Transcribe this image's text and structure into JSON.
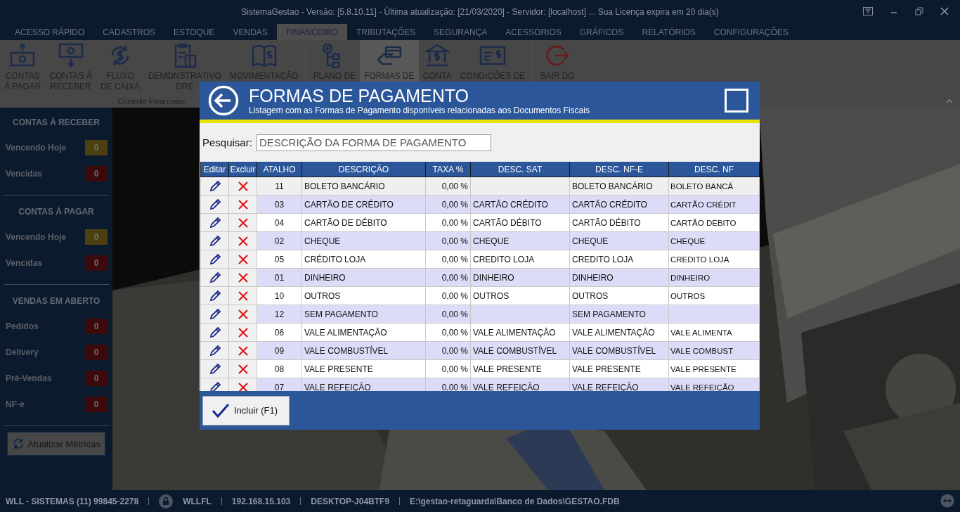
{
  "window": {
    "title": "SistemaGestao - Versão: [5.8.10.11] - Última atualização: [21/03/2020] - Servidor: [localhost] ... Sua Licença expira em 20 dia(s)"
  },
  "tabs": [
    {
      "label": "ACESSO RÁPIDO",
      "selected": false
    },
    {
      "label": "CADASTROS",
      "selected": false
    },
    {
      "label": "ESTOQUE",
      "selected": false
    },
    {
      "label": "VENDAS",
      "selected": false
    },
    {
      "label": "FINANCEIRO",
      "selected": true
    },
    {
      "label": "TRIBUTAÇÕES",
      "selected": false
    },
    {
      "label": "SEGURANÇA",
      "selected": false
    },
    {
      "label": "ACESSÓRIOS",
      "selected": false
    },
    {
      "label": "GRÁFICOS",
      "selected": false
    },
    {
      "label": "RELATÓRIOS",
      "selected": false
    },
    {
      "label": "CONFIGURAÇÕES",
      "selected": false
    }
  ],
  "ribbon": {
    "group_label": "Controle Financeiro",
    "items": [
      {
        "lines": [
          "CONTAS",
          "À PAGAR"
        ],
        "selected": false
      },
      {
        "lines": [
          "CONTAS À",
          "RECEBER"
        ],
        "selected": false
      },
      {
        "lines": [
          "FLUXO",
          "DE CAIXA"
        ],
        "selected": false
      },
      {
        "lines": [
          "DEMONSTRATIVO",
          "DRE"
        ],
        "selected": false
      },
      {
        "lines": [
          "MOVIMENTAÇÃO"
        ],
        "selected": false
      },
      {
        "lines": [
          "PLANO DE"
        ],
        "selected": false
      },
      {
        "lines": [
          "FORMAS DE"
        ],
        "selected": true
      },
      {
        "lines": [
          "CONTA"
        ],
        "selected": false
      },
      {
        "lines": [
          "CONDIÇÕES DE"
        ],
        "selected": false
      },
      {
        "lines": [
          "SAIR DO"
        ],
        "selected": false
      }
    ]
  },
  "sidebar": {
    "sections": [
      {
        "title": "CONTAS À RECEBER",
        "items": [
          {
            "label": "Vencendo Hoje",
            "count": "0",
            "color": "#4d3f0f"
          },
          {
            "label": "Vencidas",
            "count": "0",
            "color": "#3d0a0c"
          }
        ]
      },
      {
        "title": "CONTAS À PAGAR",
        "items": [
          {
            "label": "Vencendo Hoje",
            "count": "0",
            "color": "#4d3f0f"
          },
          {
            "label": "Vencidas",
            "count": "0",
            "color": "#3d0a0c"
          }
        ]
      },
      {
        "title": "VENDAS EM ABERTO",
        "items": [
          {
            "label": "Pedidos",
            "count": "0",
            "color": "#3d0a0c"
          },
          {
            "label": "Delivery",
            "count": "0",
            "color": "#3d0a0c"
          },
          {
            "label": "Pré-Vendas",
            "count": "0",
            "color": "#3d0a0c"
          },
          {
            "label": "NF-e",
            "count": "0",
            "color": "#3d0a0c"
          }
        ]
      }
    ],
    "refresh_button": "Atualizar Métricas"
  },
  "dialog": {
    "title": "FORMAS DE PAGAMENTO",
    "subtitle": "Listagem com as Formas de Pagamento disponíveis relacionadas aos Documentos Fiscais",
    "search": {
      "label": "Pesquisar:",
      "placeholder": "DESCRIÇÃO DA FORMA DE PAGAMENTO"
    },
    "table": {
      "columns": [
        "Editar",
        "Excluir",
        "ATALHO",
        "DESCRIÇÃO",
        "TAXA %",
        "DESC. SAT",
        "DESC. NF-E",
        "DESC. NF"
      ],
      "rows": [
        {
          "atalho": "11",
          "descricao": "BOLETO BANCÁRIO",
          "taxa": "0,00 %",
          "desc_sat": "",
          "desc_nfe": "BOLETO BANCÁRIO",
          "desc_nf": "BOLETO BANCÁ",
          "selected": true
        },
        {
          "atalho": "03",
          "descricao": "CARTÃO DE CRÉDITO",
          "taxa": "0,00 %",
          "desc_sat": "CARTÃO CRÉDITO",
          "desc_nfe": "CARTÃO CRÉDITO",
          "desc_nf": "CARTÃO CRÉDIT",
          "selected": false
        },
        {
          "atalho": "04",
          "descricao": "CARTÃO DE DÉBITO",
          "taxa": "0,00 %",
          "desc_sat": "CARTÃO DÉBITO",
          "desc_nfe": "CARTÃO DÉBITO",
          "desc_nf": "CARTÃO DÉBITO",
          "selected": false
        },
        {
          "atalho": "02",
          "descricao": "CHEQUE",
          "taxa": "0,00 %",
          "desc_sat": "CHEQUE",
          "desc_nfe": "CHEQUE",
          "desc_nf": "CHEQUE",
          "selected": false
        },
        {
          "atalho": "05",
          "descricao": "CRÉDITO LOJA",
          "taxa": "0,00 %",
          "desc_sat": "CREDITO LOJA",
          "desc_nfe": "CREDITO LOJA",
          "desc_nf": "CREDITO LOJA",
          "selected": false
        },
        {
          "atalho": "01",
          "descricao": "DINHEIRO",
          "taxa": "0,00 %",
          "desc_sat": "DINHEIRO",
          "desc_nfe": "DINHEIRO",
          "desc_nf": "DINHEIRO",
          "selected": false
        },
        {
          "atalho": "10",
          "descricao": "OUTROS",
          "taxa": "0,00 %",
          "desc_sat": "OUTROS",
          "desc_nfe": "OUTROS",
          "desc_nf": "OUTROS",
          "selected": false
        },
        {
          "atalho": "12",
          "descricao": "SEM PAGAMENTO",
          "taxa": "0,00 %",
          "desc_sat": "",
          "desc_nfe": "SEM PAGAMENTO",
          "desc_nf": "",
          "selected": false
        },
        {
          "atalho": "06",
          "descricao": "VALE ALIMENTAÇÃO",
          "taxa": "0,00 %",
          "desc_sat": "VALE ALIMENTAÇÃO",
          "desc_nfe": "VALE ALIMENTAÇÃO",
          "desc_nf": "VALE ALIMENTA",
          "selected": false
        },
        {
          "atalho": "09",
          "descricao": "VALE COMBUSTÍVEL",
          "taxa": "0,00 %",
          "desc_sat": "VALE COMBUSTÍVEL",
          "desc_nfe": "VALE COMBUSTÍVEL",
          "desc_nf": "VALE COMBUST",
          "selected": false
        },
        {
          "atalho": "08",
          "descricao": "VALE PRESENTE",
          "taxa": "0,00 %",
          "desc_sat": "VALE PRESENTE",
          "desc_nfe": "VALE PRESENTE",
          "desc_nf": "VALE PRESENTE",
          "selected": false
        },
        {
          "atalho": "07",
          "descricao": "VALE REFEIÇÃO",
          "taxa": "0,00 %",
          "desc_sat": "VALE REFEIÇÃO",
          "desc_nfe": "VALE REFEIÇÃO",
          "desc_nf": "VALE REFEIÇÃO",
          "selected": false
        }
      ]
    },
    "add_button": "Incluir (F1)"
  },
  "status_bar": {
    "company": "WLL - SISTEMAS (11) 99845-2278",
    "user": "WLLFL",
    "ip": "192.168.15.103",
    "machine": "DESKTOP-J04BTF9",
    "database": "E:\\gestao-retaguarda\\Banco de Dados\\GESTAO.FDB"
  }
}
